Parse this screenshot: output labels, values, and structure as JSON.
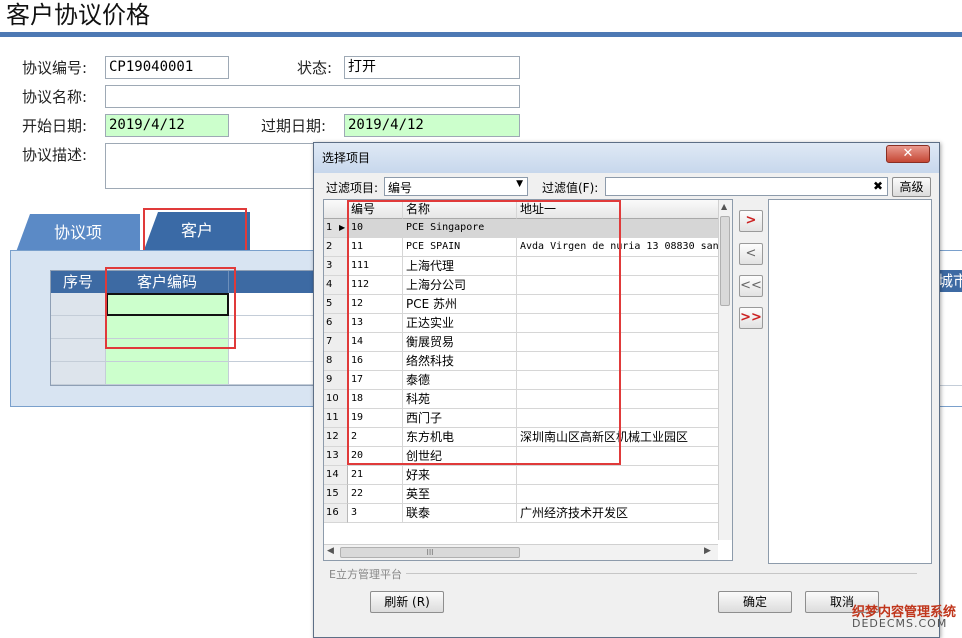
{
  "page": {
    "title": "客户协议价格",
    "fields": {
      "agreement_no_label": "协议编号:",
      "agreement_no_value": "CP19040001",
      "status_label": "状态:",
      "status_value": "打开",
      "agreement_name_label": "协议名称:",
      "agreement_name_value": "",
      "start_date_label": "开始日期:",
      "start_date_value": "2019/4/12",
      "expire_date_label": "过期日期:",
      "expire_date_value": "2019/4/12",
      "description_label": "协议描述:",
      "description_value": ""
    },
    "tabs": [
      {
        "label": "协议项",
        "active": false
      },
      {
        "label": "客户",
        "active": true
      }
    ],
    "grid": {
      "col_seq": "序号",
      "col_customer_code": "客户编码",
      "col_city_partial": "城市"
    }
  },
  "dialog": {
    "title": "选择项目",
    "close_symbol": "✕",
    "filter_item_label": "过滤项目:",
    "filter_item_value": "编号",
    "filter_value_label": "过滤值(F):",
    "filter_value": "",
    "clear_symbol": "✖",
    "advanced_button": "高级",
    "columns": [
      "编号",
      "名称",
      "地址一"
    ],
    "rows": [
      {
        "n": "1",
        "code": "10",
        "name": "PCE Singapore",
        "addr": ""
      },
      {
        "n": "2",
        "code": "11",
        "name": "PCE SPAIN",
        "addr": "Avda Virgen de nuria 13 08830 san"
      },
      {
        "n": "3",
        "code": "111",
        "name": "上海代理",
        "addr": ""
      },
      {
        "n": "4",
        "code": "112",
        "name": "上海分公司",
        "addr": ""
      },
      {
        "n": "5",
        "code": "12",
        "name": "PCE 苏州",
        "addr": ""
      },
      {
        "n": "6",
        "code": "13",
        "name": "正达实业",
        "addr": ""
      },
      {
        "n": "7",
        "code": "14",
        "name": "衡展贸易",
        "addr": ""
      },
      {
        "n": "8",
        "code": "16",
        "name": "络然科技",
        "addr": ""
      },
      {
        "n": "9",
        "code": "17",
        "name": "泰德",
        "addr": ""
      },
      {
        "n": "10",
        "code": "18",
        "name": "科苑",
        "addr": ""
      },
      {
        "n": "11",
        "code": "19",
        "name": "西门子",
        "addr": ""
      },
      {
        "n": "12",
        "code": "2",
        "name": "东方机电",
        "addr": "深圳南山区高新区机械工业园区"
      },
      {
        "n": "13",
        "code": "20",
        "name": "创世纪",
        "addr": ""
      },
      {
        "n": "14",
        "code": "21",
        "name": "好来",
        "addr": ""
      },
      {
        "n": "15",
        "code": "22",
        "name": "英至",
        "addr": ""
      },
      {
        "n": "16",
        "code": "3",
        "name": "联泰",
        "addr": "广州经济技术开发区"
      }
    ],
    "selected_row": 1,
    "side_buttons": [
      ">",
      "<",
      "<<",
      ">>"
    ],
    "hscroll_grip": "III",
    "platform_label": "E立方管理平台",
    "refresh_button": "刷新 (R)",
    "ok_button": "确定",
    "cancel_button": "取消"
  },
  "watermark": {
    "line1": "织梦内容管理系统",
    "line2": "DEDECMS.COM"
  }
}
